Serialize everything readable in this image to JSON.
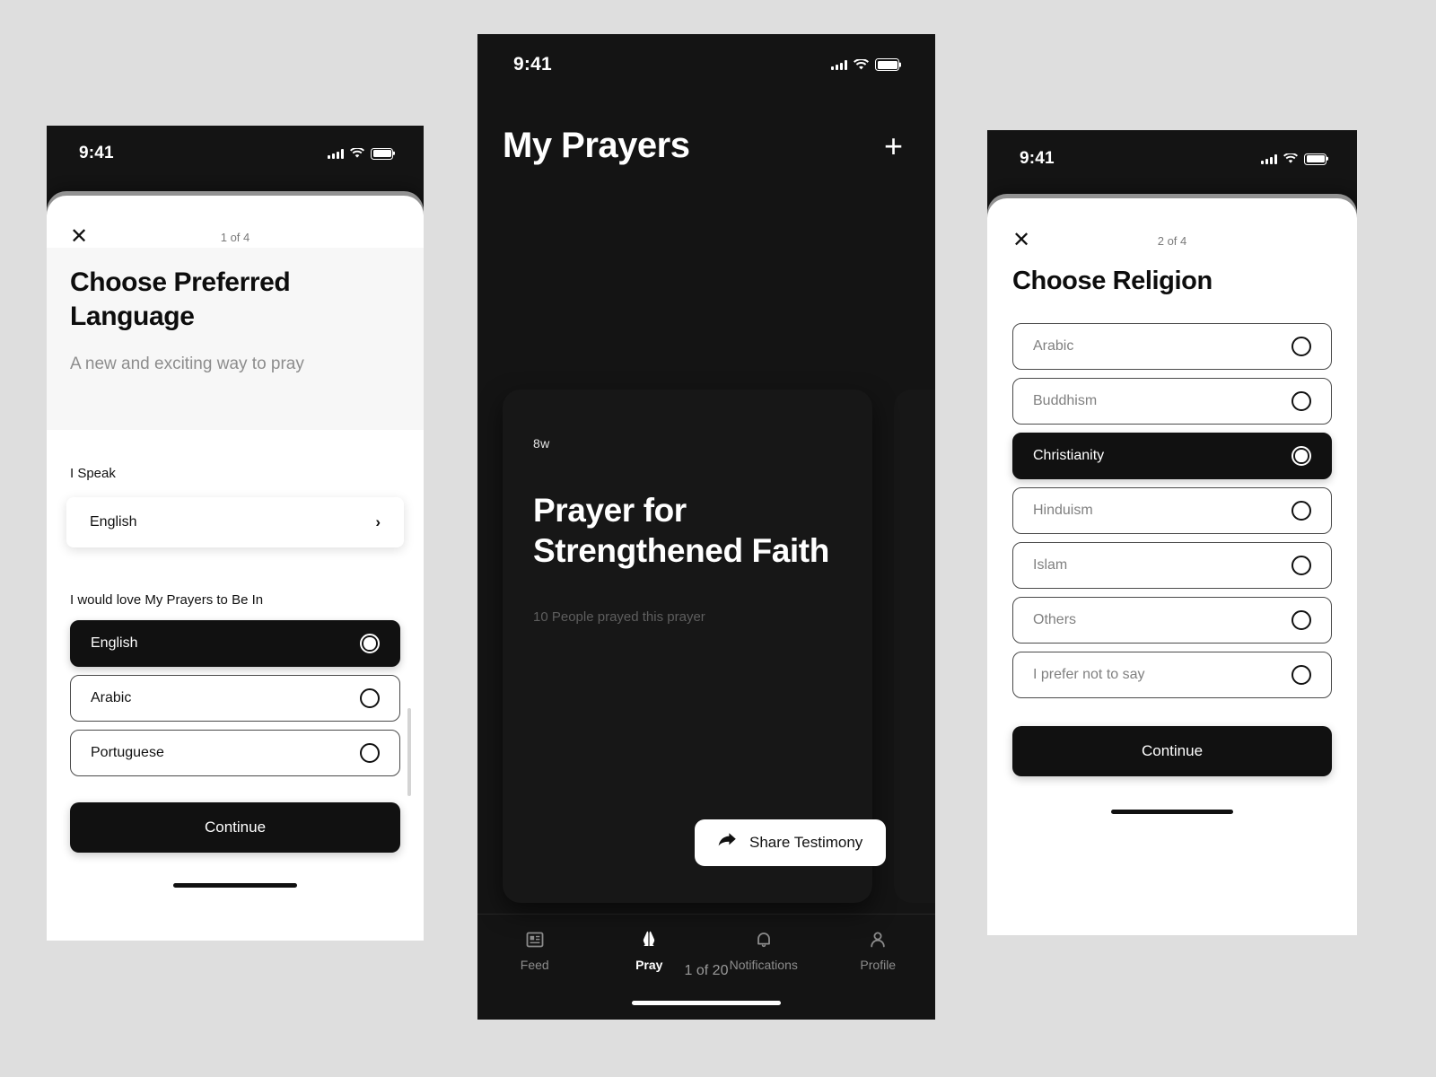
{
  "theme": {
    "page_background": "#dedede",
    "dark": "#141414",
    "accent_dark": "#111111",
    "light": "#ffffff",
    "muted_text": "#808080"
  },
  "phone_language": {
    "status_bar": {
      "time": "9:41",
      "signal_icon": "cellular-signal-icon",
      "wifi_icon": "wifi-icon",
      "battery_icon": "battery-icon"
    },
    "sheet": {
      "close_icon": "close-icon",
      "step_label": "1 of 4",
      "title": "Choose Preferred Language",
      "subtitle": "A new and exciting way to pray",
      "speak_label": "I Speak",
      "speak_value": "English",
      "speak_chevron_icon": "chevron-right-icon",
      "prayers_label": "I would love My Prayers to Be In",
      "options": [
        {
          "label": "English",
          "selected": true
        },
        {
          "label": "Arabic",
          "selected": false
        },
        {
          "label": "Portuguese",
          "selected": false
        }
      ],
      "continue_label": "Continue"
    }
  },
  "phone_prayers": {
    "status_bar": {
      "time": "9:41",
      "signal_icon": "cellular-signal-icon",
      "wifi_icon": "wifi-icon",
      "battery_icon": "battery-icon"
    },
    "header": {
      "title": "My  Prayers",
      "add_icon": "plus-icon"
    },
    "card": {
      "age": "8w",
      "title": "Prayer for Strengthened Faith",
      "meta": "10 People prayed this prayer",
      "share_icon": "share-arrow-icon",
      "share_label": "Share Testimony"
    },
    "pager": "1 of 20",
    "tabs": [
      {
        "label": "Feed",
        "icon": "feed-icon",
        "active": false
      },
      {
        "label": "Pray",
        "icon": "praying-hands-icon",
        "active": true
      },
      {
        "label": "Notifications",
        "icon": "bell-icon",
        "active": false
      },
      {
        "label": "Profile",
        "icon": "person-icon",
        "active": false
      }
    ]
  },
  "phone_religion": {
    "status_bar": {
      "time": "9:41",
      "signal_icon": "cellular-signal-icon",
      "wifi_icon": "wifi-icon",
      "battery_icon": "battery-icon"
    },
    "sheet": {
      "close_icon": "close-icon",
      "step_label": "2 of 4",
      "title": "Choose Religion",
      "options": [
        {
          "label": "Arabic",
          "selected": false
        },
        {
          "label": "Buddhism",
          "selected": false
        },
        {
          "label": "Christianity",
          "selected": true
        },
        {
          "label": "Hinduism",
          "selected": false
        },
        {
          "label": "Islam",
          "selected": false
        },
        {
          "label": "Others",
          "selected": false
        },
        {
          "label": "I prefer not to say",
          "selected": false
        }
      ],
      "continue_label": "Continue"
    }
  }
}
